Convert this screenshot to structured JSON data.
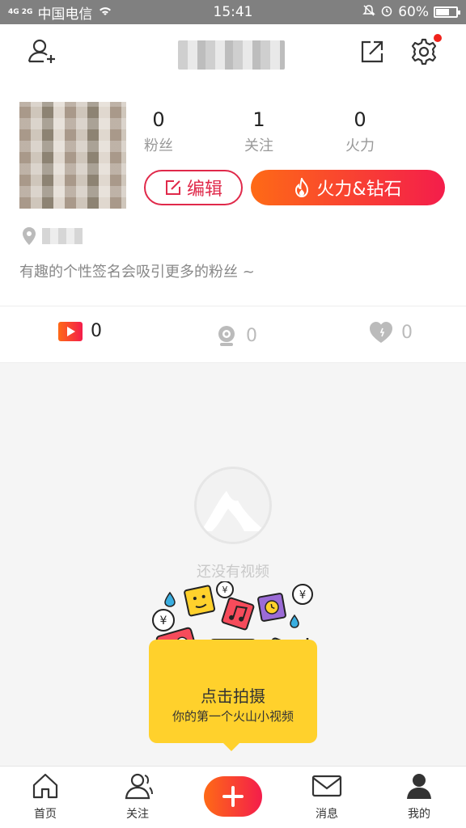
{
  "status_bar": {
    "signal": "4G 2G",
    "carrier": "中国电信",
    "time": "15:41",
    "battery": "60%"
  },
  "profile": {
    "stats": [
      {
        "value": "0",
        "label": "粉丝"
      },
      {
        "value": "1",
        "label": "关注"
      },
      {
        "value": "0",
        "label": "火力"
      }
    ],
    "edit_label": "编辑",
    "fire_label": "火力&钻石",
    "bio": "有趣的个性签名会吸引更多的粉丝 ~"
  },
  "tabs": [
    {
      "icon": "video-play-icon",
      "count": "0"
    },
    {
      "icon": "camera-icon",
      "count": "0"
    },
    {
      "icon": "heart-icon",
      "count": "0"
    }
  ],
  "empty": {
    "text": "还没有视频"
  },
  "promo": {
    "title": "点击拍摄",
    "subtitle": "你的第一个火山小视频"
  },
  "nav": [
    {
      "label": "首页",
      "icon": "home-icon"
    },
    {
      "label": "关注",
      "icon": "friends-icon"
    },
    {
      "label": "",
      "icon": "plus-icon"
    },
    {
      "label": "消息",
      "icon": "mail-icon"
    },
    {
      "label": "我的",
      "icon": "user-icon"
    }
  ],
  "colors": {
    "accent_red": "#e0294a",
    "gradient_start": "#fe6a16",
    "gradient_end": "#f41d4b",
    "promo_yellow": "#ffd12c"
  }
}
